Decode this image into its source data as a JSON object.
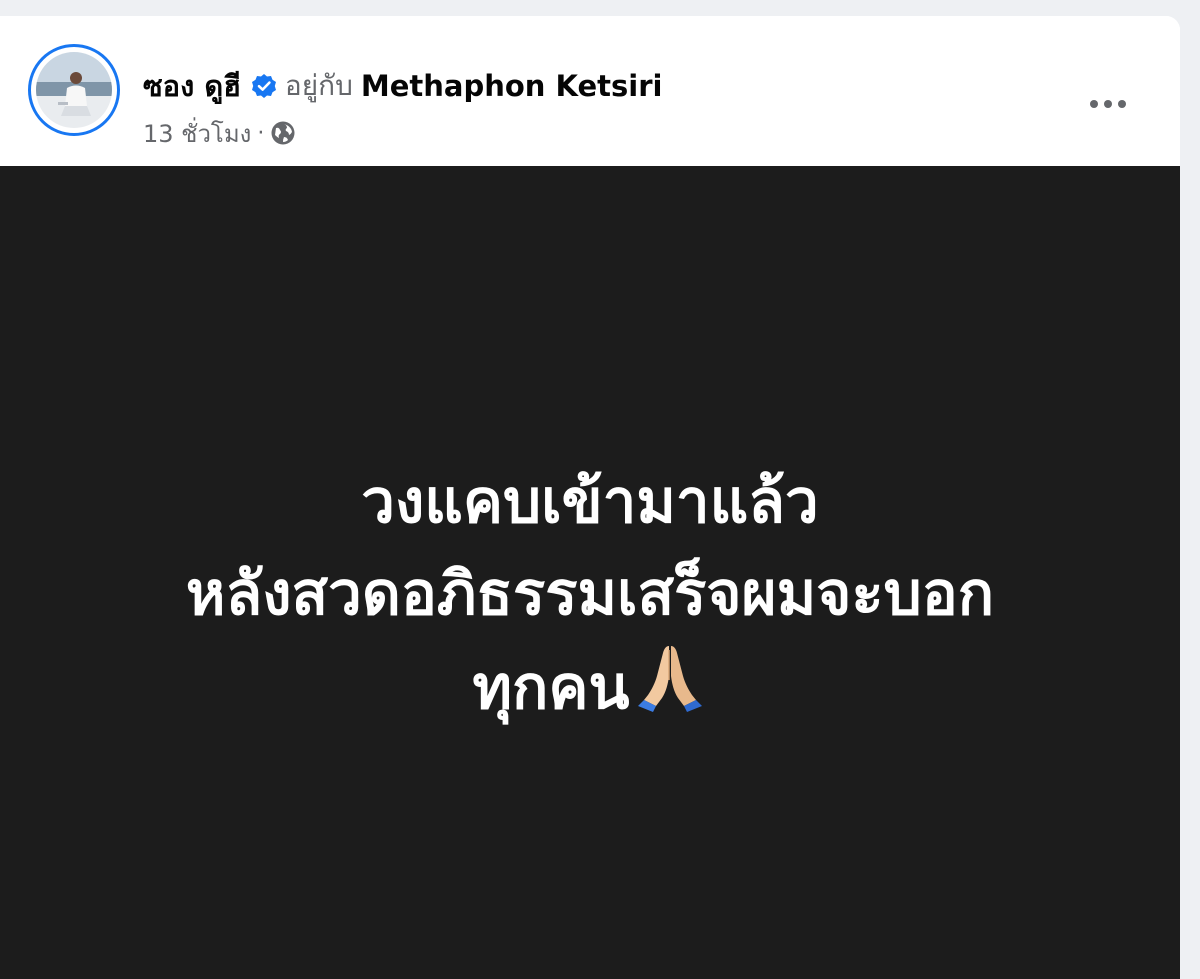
{
  "post": {
    "author": {
      "name": "ซอง ดูฮี",
      "verified": true,
      "avatar_icon": "profile-photo"
    },
    "with_label": "อยู่กับ",
    "tagged_name": "Methaphon Ketsiri",
    "timestamp": "13 ชั่วโมง",
    "separator": "·",
    "audience_icon": "globe-icon",
    "more_icon": "more-options-icon",
    "status": {
      "background": "#1c1c1c",
      "text_color": "#ffffff",
      "lines": [
        "วงแคบเข้ามาแล้ว",
        "หลังสวดอภิธรรมเสร็จผมจะบอก",
        "ทุกคน"
      ],
      "emoji_icon": "folded-hands-icon"
    }
  },
  "colors": {
    "accent": "#1877f2",
    "secondary_text": "#65676b",
    "primary_text": "#050505"
  }
}
